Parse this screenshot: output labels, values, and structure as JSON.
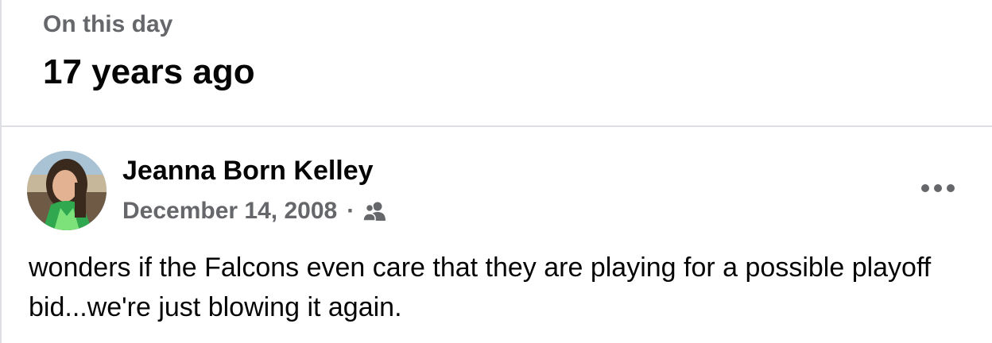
{
  "memory_header": {
    "subtitle": "On this day",
    "title": "17 years ago"
  },
  "post": {
    "author_name": "Jeanna Born Kelley",
    "date": "December 14, 2008",
    "separator": "·",
    "audience_icon": "friends-icon",
    "more_icon": "more-options-icon",
    "text": "wonders if the Falcons even care that they are playing for a possible playoff bid...we're just blowing it again."
  },
  "colors": {
    "primary_text": "#050505",
    "secondary_text": "#65676b",
    "divider": "#dddfe2",
    "background": "#ffffff"
  }
}
